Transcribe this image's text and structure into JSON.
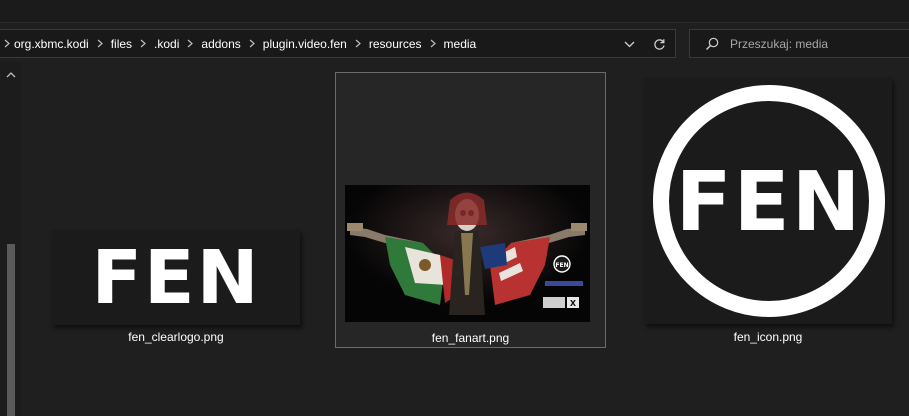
{
  "address_bar": {
    "breadcrumbs": [
      "org.xbmc.kodi",
      "files",
      ".kodi",
      "addons",
      "plugin.video.fen",
      "resources",
      "media"
    ],
    "icons": {
      "separator": "chevron-right-icon",
      "dropdown": "chevron-down-icon",
      "refresh": "refresh-icon"
    }
  },
  "search": {
    "placeholder": "Przeszukaj: media",
    "value": "",
    "icon": "search-icon"
  },
  "files": [
    {
      "name": "fen_clearlogo.png",
      "selected": false,
      "thumb_text": "FEN"
    },
    {
      "name": "fen_fanart.png",
      "selected": true,
      "thumb_text": "FEN"
    },
    {
      "name": "fen_icon.png",
      "selected": false,
      "thumb_text": "FEN"
    }
  ],
  "colors": {
    "background": "#1f1f1f",
    "selection_border": "#6b6b6b",
    "text": "#ffffff"
  }
}
